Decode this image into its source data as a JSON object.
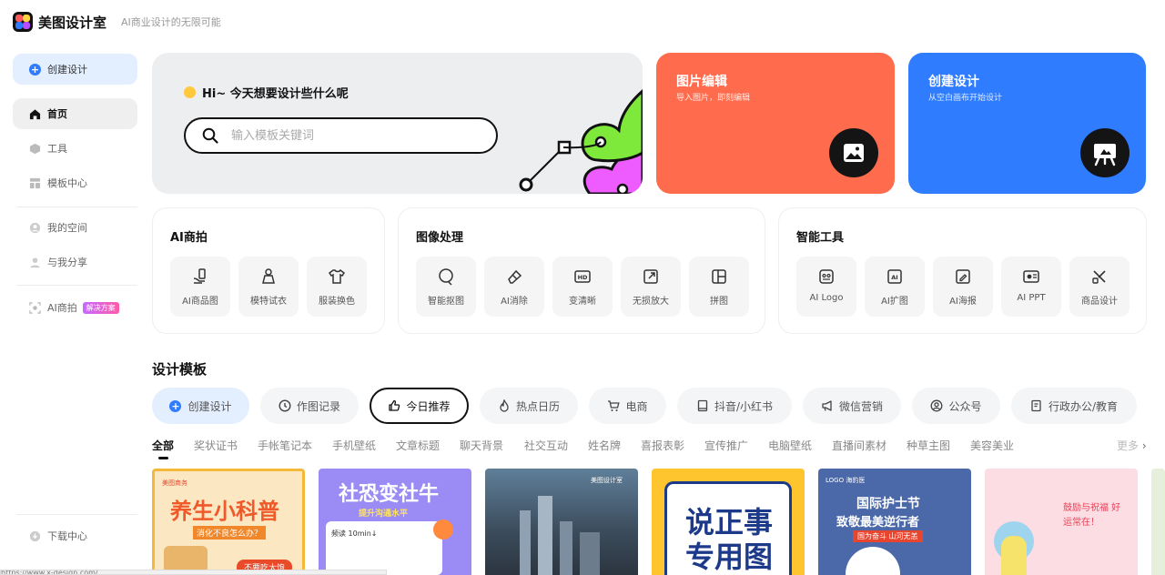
{
  "brand": {
    "name": "美图设计室",
    "slogan": "AI商业设计的无限可能"
  },
  "sidebar": {
    "create_label": "创建设计",
    "items": [
      {
        "label": "首页"
      },
      {
        "label": "工具"
      },
      {
        "label": "模板中心"
      },
      {
        "label": "我的空间"
      },
      {
        "label": "与我分享"
      },
      {
        "label": "AI商拍",
        "badge": "解决方案"
      }
    ],
    "download_label": "下载中心"
  },
  "hero": {
    "question": "Hi~ 今天想要设计些什么呢",
    "search_placeholder": "输入模板关键词"
  },
  "cards": {
    "edit": {
      "title": "图片编辑",
      "subtitle": "导入图片，即刻编辑",
      "color": "#ff6b4d"
    },
    "create": {
      "title": "创建设计",
      "subtitle": "从空白画布开始设计",
      "color": "#2f7cff"
    }
  },
  "tool_groups": [
    {
      "title": "AI商拍",
      "tools": [
        {
          "label": "AI商品图"
        },
        {
          "label": "模特试衣"
        },
        {
          "label": "服装换色"
        }
      ]
    },
    {
      "title": "图像处理",
      "tools": [
        {
          "label": "智能抠图"
        },
        {
          "label": "AI消除"
        },
        {
          "label": "变清晰"
        },
        {
          "label": "无损放大"
        },
        {
          "label": "拼图"
        }
      ]
    },
    {
      "title": "智能工具",
      "tools": [
        {
          "label": "AI Logo"
        },
        {
          "label": "AI扩图"
        },
        {
          "label": "AI海报"
        },
        {
          "label": "AI PPT"
        },
        {
          "label": "商品设计"
        }
      ]
    }
  ],
  "templates": {
    "title": "设计模板",
    "pills": [
      {
        "label": "创建设计"
      },
      {
        "label": "作图记录"
      },
      {
        "label": "今日推荐"
      },
      {
        "label": "热点日历"
      },
      {
        "label": "电商"
      },
      {
        "label": "抖音/小红书"
      },
      {
        "label": "微信营销"
      },
      {
        "label": "公众号"
      },
      {
        "label": "行政办公/教育"
      }
    ],
    "categories": [
      "全部",
      "奖状证书",
      "手帐笔记本",
      "手机壁纸",
      "文章标题",
      "聊天背景",
      "社交互动",
      "姓名牌",
      "喜报表彰",
      "宣传推广",
      "电脑壁纸",
      "直播间素材",
      "种草主图",
      "美容美业"
    ],
    "more_label": "更多",
    "thumbs": [
      {
        "tag": "美图商务",
        "title": "养生小科普",
        "sub": "消化不良怎么办？",
        "extra": "不要吃太饱"
      },
      {
        "title": "社恐变社牛",
        "sub": "提升沟通水平",
        "extra": "频读 10min↓"
      },
      {
        "tag": "美图设计室"
      },
      {
        "title": "说正事专用图"
      },
      {
        "tag": "LOGO 海豹医",
        "title": "国际护士节",
        "sub": "致敬最美逆行者",
        "extra": "国为奋斗 山河无恙"
      },
      {
        "title": "鼓励与祝福 好运常在！"
      }
    ]
  },
  "status_url": "https://www.x-design.com/"
}
